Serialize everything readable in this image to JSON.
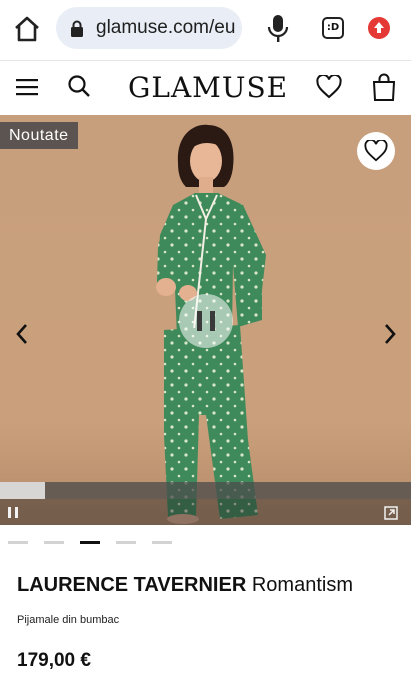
{
  "browser": {
    "url": "glamuse.com/eu",
    "tab_count": ":D",
    "icons": [
      "home-icon",
      "lock-icon",
      "mic-icon",
      "tabs-icon",
      "update-icon"
    ]
  },
  "header": {
    "logo": "GLAMUSE",
    "icons": [
      "menu-icon",
      "search-icon",
      "heart-icon",
      "bag-icon"
    ]
  },
  "gallery": {
    "badge": "Noutate",
    "progress": 0.11,
    "slide_count": 5,
    "active_slide": 3,
    "colors": {
      "backdrop": "#c9a07e",
      "pajama": "#3f8a5a",
      "badge": "#5b5450"
    }
  },
  "product": {
    "brand": "LAURENCE TAVERNIER",
    "name": "Romantism",
    "subtitle": "Pijamale din bumbac",
    "price": "179,00 €"
  }
}
